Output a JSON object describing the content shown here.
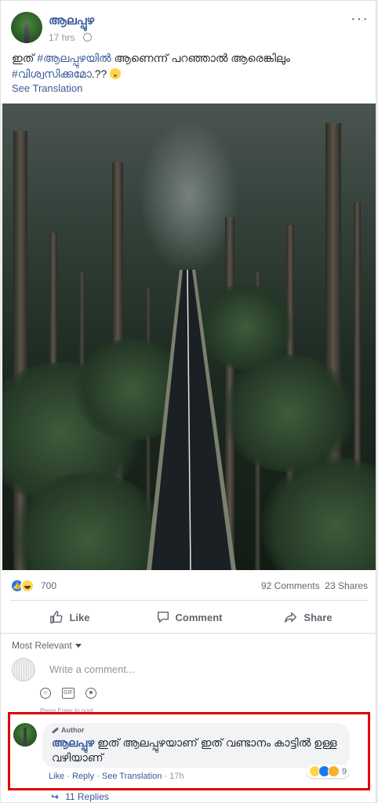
{
  "post": {
    "page_name": "ആലപ്പുഴ",
    "time": "17 hrs",
    "privacy_icon": "globe-icon",
    "more_icon": "more-options-icon",
    "text_before": "ഇത് ",
    "hashtag1": "#ആലപ്പുഴയിൽ",
    "text_middle": " ആണെന്ന് പറഞ്ഞാൽ ആരെങ്കിലും",
    "hashtag2": "#വിശ്വസിക്കുമോ",
    "text_after": ".?? ",
    "emoji": "blush-emoji",
    "see_translation": "See Translation",
    "image_alt": "Aerial view of a road through a dense forest"
  },
  "stats": {
    "reactions_count": "700",
    "comments": "92 Comments",
    "shares": "23 Shares"
  },
  "actions": {
    "like": "Like",
    "comment": "Comment",
    "share": "Share"
  },
  "comments_section": {
    "sort_label": "Most Relevant",
    "placeholder": "Write a comment...",
    "hint": "Press Enter to post.",
    "icons": [
      "emoji-icon",
      "gif-icon",
      "sticker-icon"
    ]
  },
  "comment": {
    "badge": "Author",
    "author": "ആലപ്പുഴ",
    "text": "ഇത് ആലപ്പുഴയാണ് ഇത് വണ്ടാനം കാട്ടിൽ ഉള്ള വഴിയാണ്",
    "like": "Like",
    "reply": "Reply",
    "see_translation": "See Translation",
    "time": "17h",
    "reactions_count": "9",
    "replies": "11 Replies"
  },
  "colors": {
    "link": "#385898",
    "highlight": "#e00000",
    "like_blue": "#1877f2"
  }
}
